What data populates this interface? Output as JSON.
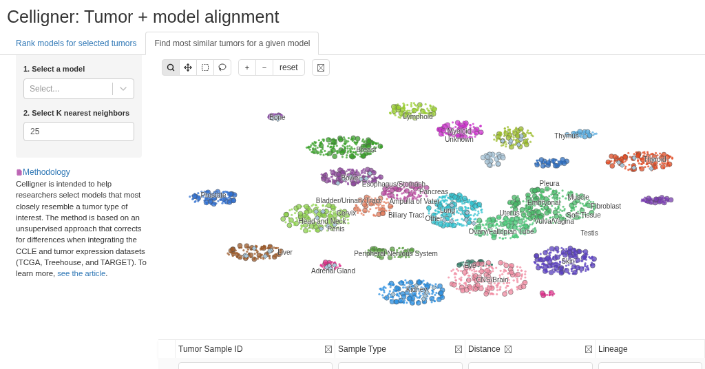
{
  "title": "Celligner: Tumor + model alignment",
  "tabs": [
    {
      "label": "Rank models for selected tumors",
      "selected": false
    },
    {
      "label": "Find most similar tumors for a given model",
      "selected": true
    }
  ],
  "form": {
    "model_label": "1. Select a model",
    "model_placeholder": "Select...",
    "k_label": "2. Select K nearest neighbors",
    "k_value": "25"
  },
  "methodology": {
    "link": "Methodology",
    "text": "Celligner is intended to help researchers select models that most closely resemble a tumor type of interest. The method is based on an unsupervised approach that corrects for differences when integrating the CCLE and tumor expression datasets (TCGA, Treehouse, and TARGET). To learn more, ",
    "article_link": "see the article",
    "end": "."
  },
  "toolbar": {
    "modes": [
      {
        "kind": "zoom",
        "selected": true
      },
      {
        "kind": "pan",
        "selected": false
      },
      {
        "kind": "box",
        "selected": false
      },
      {
        "kind": "lasso",
        "selected": false
      }
    ],
    "zoom_in": "+",
    "zoom_out": "−",
    "reset": "reset"
  },
  "plot": {
    "labels": [
      "Bone",
      "Lymphoid",
      "Myeloid",
      "Unknown",
      "Thymus",
      "Breast",
      "Thyroid",
      "Bowel",
      "Esophagus/Stomach",
      "Pleura",
      "Prostate",
      "Pancreas",
      "Bladder/Urinary Tract",
      "Ampulla of Vater",
      "Embryonal",
      "Muscle",
      "Fibroblast",
      "Cervix",
      "Lung",
      "Biliary Tract",
      "Other",
      "Uterus",
      "Soft Tissue",
      "Head and Neck",
      "Penis",
      "Vulva/Vagina",
      "Ovary/Fallopian Tube",
      "Testis",
      "Liver",
      "Peripheral Nervous System",
      "Skin",
      "Eye",
      "Adrenal Gland",
      "CNS/Brain",
      "Kidney"
    ]
  },
  "table": {
    "columns": [
      "Tumor Sample ID",
      "Sample Type",
      "Distance",
      "Lineage"
    ]
  }
}
